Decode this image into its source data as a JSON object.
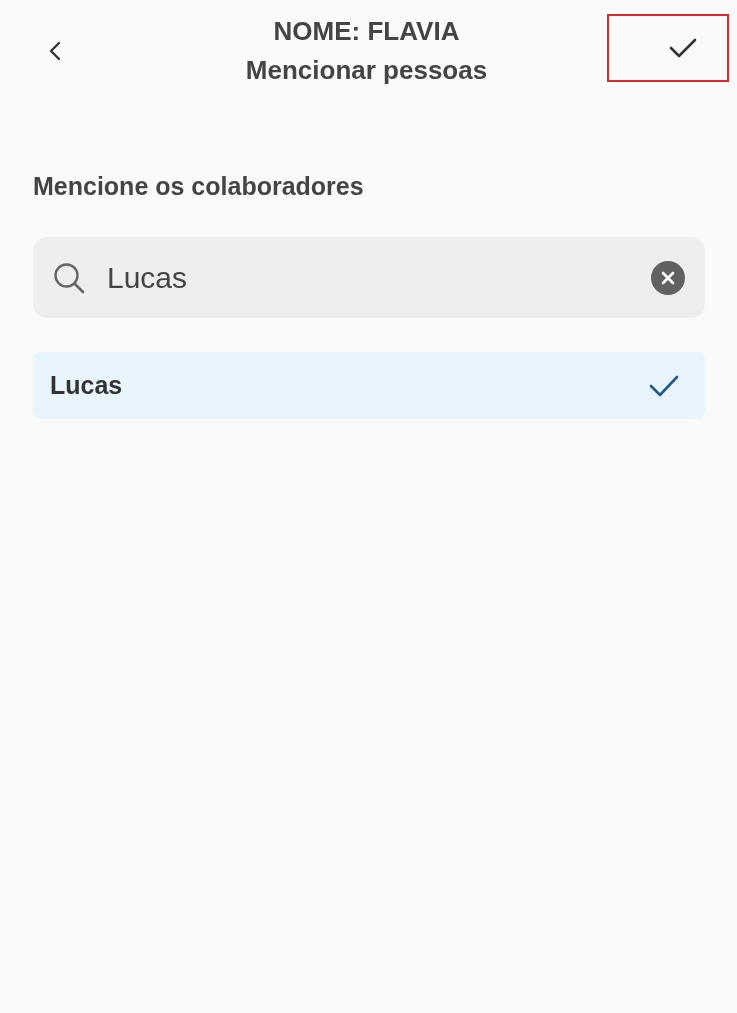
{
  "header": {
    "title": "NOME: FLAVIA",
    "subtitle": "Mencionar pessoas",
    "confirm_button": {
      "highlighted": true
    }
  },
  "section": {
    "heading": "Mencione os colaboradores"
  },
  "search": {
    "value": "Lucas"
  },
  "results": [
    {
      "name": "Lucas",
      "selected": true
    }
  ]
}
